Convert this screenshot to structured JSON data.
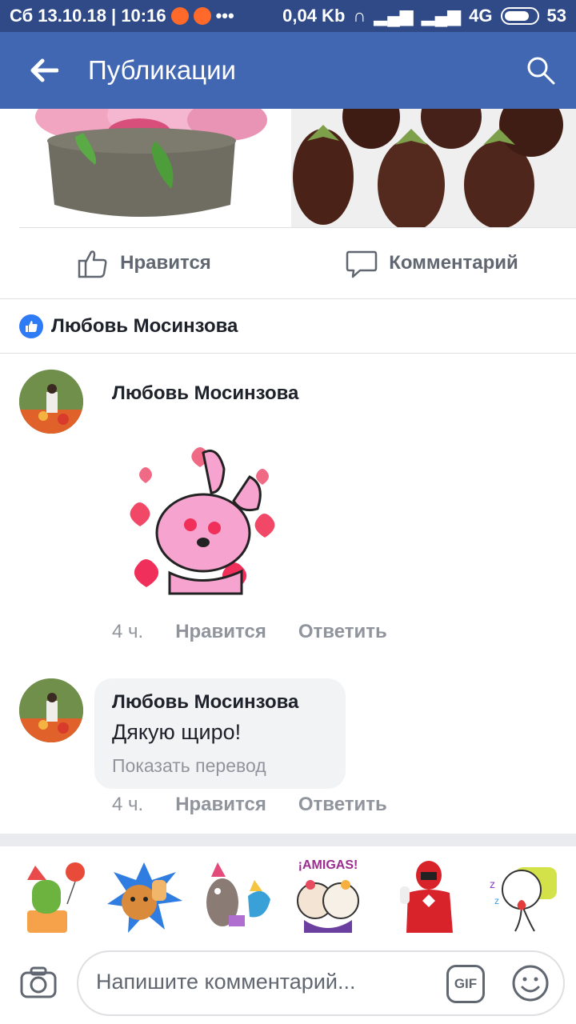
{
  "status_bar": {
    "datetime": "Сб 13.10.18 | 10:16",
    "ellipsis": "•••",
    "network_speed": "0,04 Kb",
    "network_type": "4G",
    "battery": "53"
  },
  "app_bar": {
    "title": "Публикации"
  },
  "post_actions": {
    "like_label": "Нравится",
    "comment_label": "Комментарий"
  },
  "liked_by": {
    "name": "Любовь Мосинзова"
  },
  "comments": [
    {
      "author": "Любовь Мосинзова",
      "time": "4 ч.",
      "like_label": "Нравится",
      "reply_label": "Ответить"
    },
    {
      "author": "Любовь Мосинзова",
      "text": "Дякую щиро!",
      "translate_label": "Показать перевод",
      "time": "4 ч.",
      "like_label": "Нравится",
      "reply_label": "Ответить"
    }
  ],
  "sticker_tray": {
    "amigas_text": "¡AMIGAS!"
  },
  "composer": {
    "placeholder": "Напишите комментарий...",
    "gif_label": "GIF"
  },
  "colors": {
    "status_bar": "#2f4a86",
    "app_bar": "#4267b2",
    "like_blue": "#2f7bf5",
    "meta_gray": "#90949c",
    "bubble_bg": "#f2f3f5"
  }
}
